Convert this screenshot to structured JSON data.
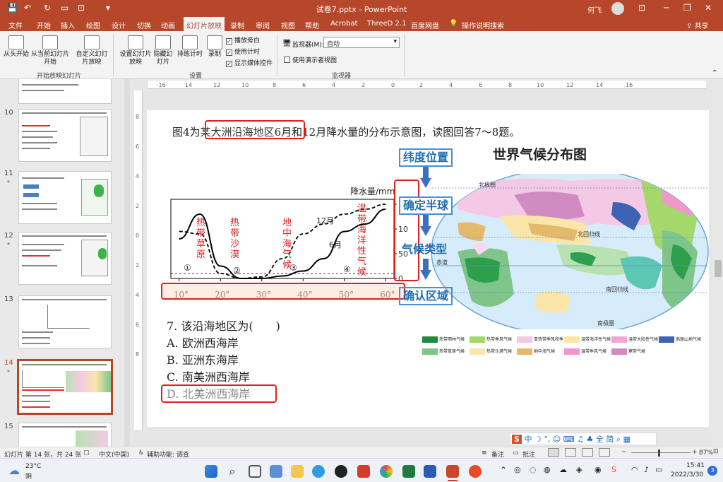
{
  "window": {
    "title": "试卷7.pptx - PowerPoint",
    "user": "何飞"
  },
  "ribbon_tabs": [
    "文件",
    "开始",
    "插入",
    "绘图",
    "设计",
    "切换",
    "动画",
    "幻灯片放映",
    "录制",
    "审阅",
    "视图",
    "帮助",
    "Acrobat",
    "ThreeD 2.1",
    "百度网盘",
    "操作说明搜索"
  ],
  "share_label": "共享",
  "ribbon": {
    "from_start": "从头开始",
    "from_current": "从当前幻灯片开始",
    "custom_show": "自定义幻灯片放映",
    "group_start": "开始放映幻灯片",
    "setup_show": "设置幻灯片放映",
    "hide_slide": "隐藏幻灯片",
    "rehearse": "排练计时",
    "record": "录制",
    "chk_narration": "播放旁白",
    "chk_timings": "使用计时",
    "chk_media": "显示媒体控件",
    "group_setup": "设置",
    "monitor_label": "监视器(M):",
    "monitor_value": "自动",
    "chk_presenter": "使用演示者视图",
    "group_monitor": "监视器"
  },
  "thumbnails": [
    {
      "num": "10"
    },
    {
      "num": "11"
    },
    {
      "num": "12"
    },
    {
      "num": "13"
    },
    {
      "num": "14"
    },
    {
      "num": "15"
    }
  ],
  "slide": {
    "question_pre": "图4为",
    "question_box": "某大洲沿海地区",
    "question_post": "6月和12月降水量的分布示意图，读图回答7～8题。",
    "map_title": "世界气候分布图",
    "steps": [
      "纬度位置",
      "确定半球",
      "气候类型",
      "确认区域"
    ],
    "chart_ylabel": "降水量/mm",
    "y_ticks": [
      "150",
      "100",
      "50",
      "0"
    ],
    "x_ticks": [
      "10°",
      "20°",
      "30°",
      "40°",
      "50°",
      "60°"
    ],
    "climate_labels": [
      "热带草原",
      "热带沙漠",
      "地中海气候",
      "温带海洋性气候"
    ],
    "circled": [
      "①",
      "②",
      "③",
      "④"
    ],
    "series_labels": [
      "12月",
      "6月"
    ],
    "q7": "7. 该沿海地区为(　　)",
    "options": [
      "A. 欧洲西海岸",
      "B. 亚洲东海岸",
      "C. 南美洲西海岸",
      "D. 北美洲西海岸"
    ],
    "map_labels": [
      "北极圈",
      "北回归线",
      "赤道",
      "南回归线",
      "南极圈"
    ],
    "legend": [
      "热带雨林气候",
      "热带季风气候",
      "亚热带季风和季风性湿润气候",
      "温带海洋性气候",
      "温带大陆性气候",
      "高原山地气候",
      "热带草原气候",
      "热带沙漠气候",
      "地中海气候",
      "温带季风气候",
      "寒带气候"
    ]
  },
  "chart_data": {
    "type": "line",
    "title": "",
    "xlabel": "",
    "ylabel": "降水量/mm",
    "x": [
      10,
      15,
      20,
      25,
      30,
      35,
      40,
      45,
      50,
      55,
      60
    ],
    "ylim": [
      0,
      160
    ],
    "xlim": [
      8,
      62
    ],
    "series": [
      {
        "name": "6月",
        "values": [
          80,
          130,
          25,
          0,
          0,
          5,
          15,
          40,
          95,
          110,
          140
        ]
      },
      {
        "name": "12月",
        "values": [
          95,
          90,
          10,
          0,
          3,
          40,
          90,
          110,
          130,
          140,
          150
        ]
      }
    ]
  },
  "status": {
    "slide_info": "幻灯片 第 14 张，共 24 张",
    "lang": "中文(中国)",
    "accessibility": "辅助功能: 调查",
    "notes": "备注",
    "comments": "批注",
    "zoom": "87%"
  },
  "taskbar": {
    "temp": "23°C",
    "weather": "阴",
    "time": "15:41",
    "date": "2022/3/30",
    "notif": "3"
  },
  "colors": {
    "accent": "#b7472a",
    "highlight": "#e02020",
    "step_blue": "#1e6fb3"
  }
}
